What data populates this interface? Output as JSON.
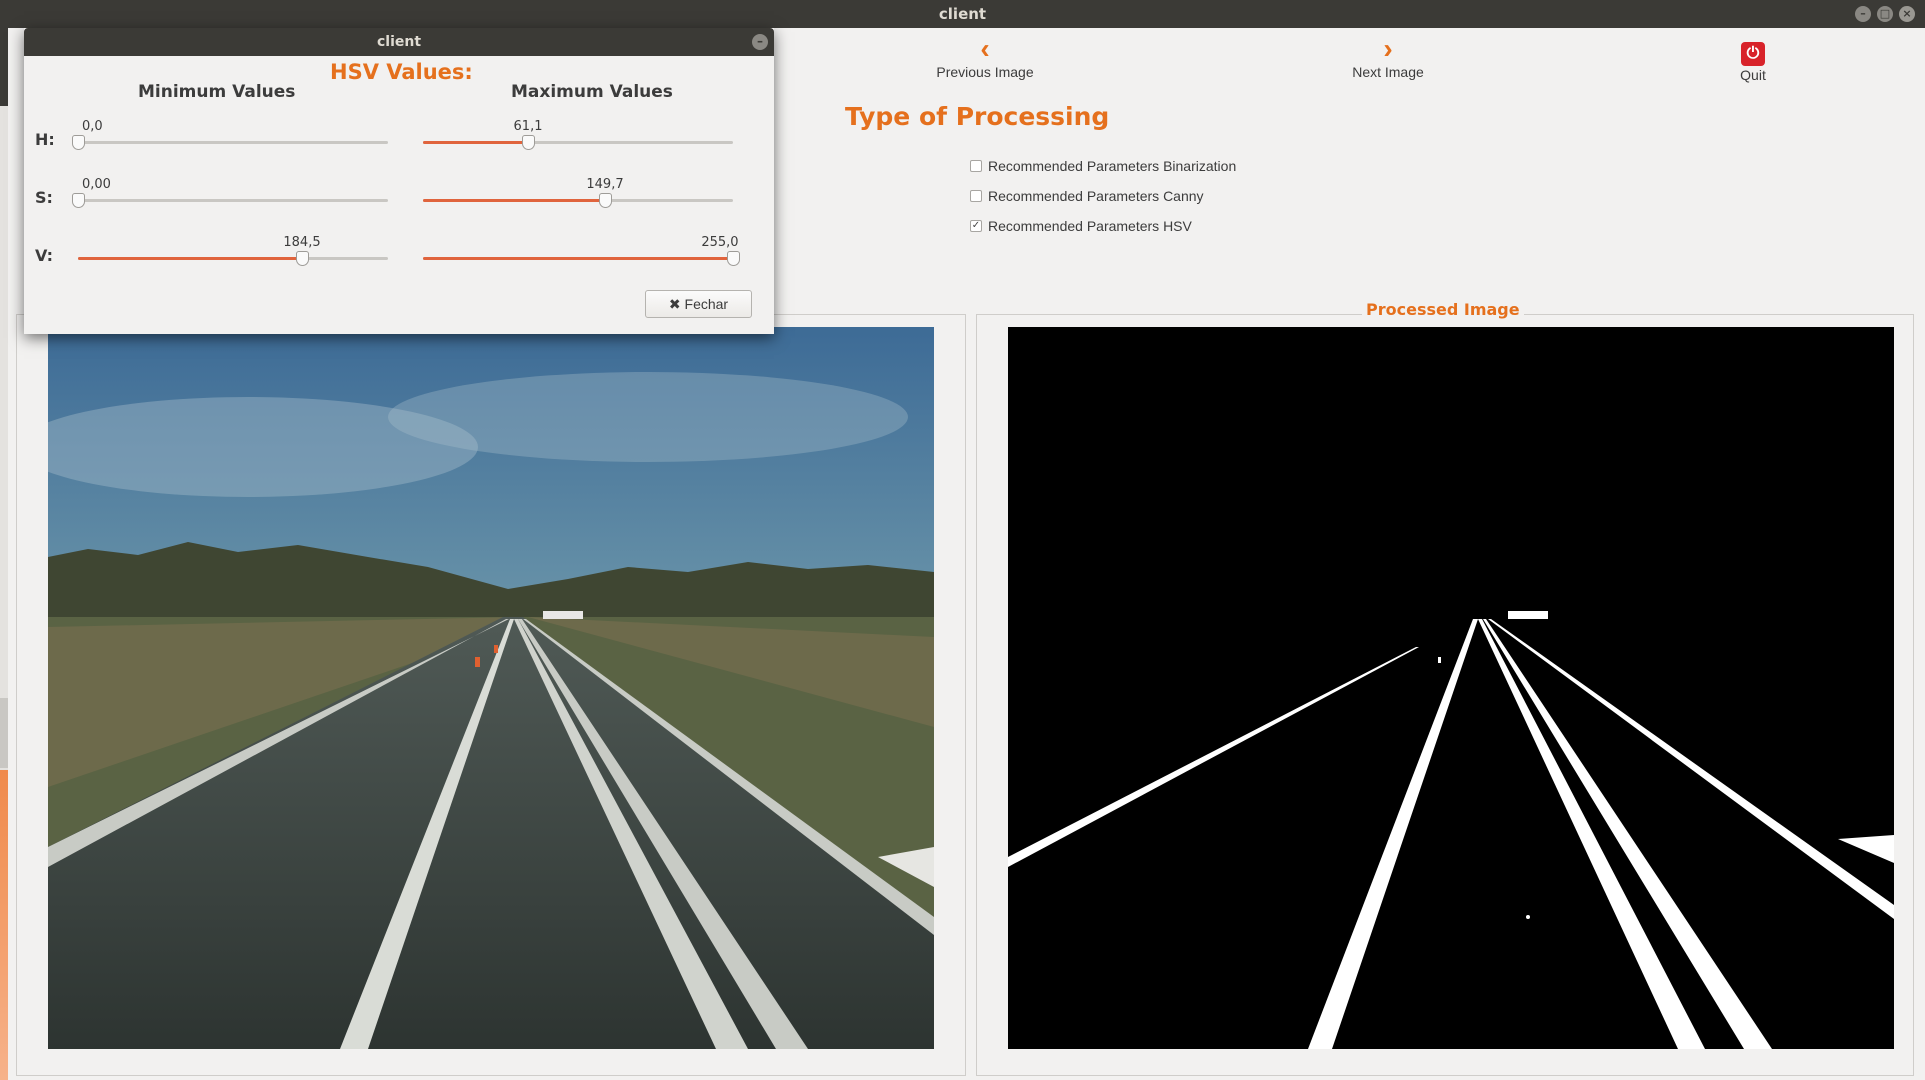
{
  "window": {
    "title": "client",
    "controls": [
      "–",
      "□",
      "×"
    ]
  },
  "toolbar": {
    "previous": {
      "label": "Previous Image",
      "icon": "‹"
    },
    "next": {
      "label": "Next Image",
      "icon": "›"
    },
    "quit": {
      "label": "Quit",
      "icon": "⏻"
    }
  },
  "processing": {
    "title": "Type of Processing",
    "options": [
      {
        "label": "Recommended Parameters Binarization",
        "checked": false
      },
      {
        "label": "Recommended Parameters Canny",
        "checked": false
      },
      {
        "label": "Recommended Parameters HSV",
        "checked": true
      }
    ]
  },
  "panels": {
    "processed_title": "Processed Image"
  },
  "dialog": {
    "title": "client",
    "heading": "HSV Values:",
    "min_header": "Minimum Values",
    "max_header": "Maximum Values",
    "rows": [
      {
        "label": "H:",
        "min": "0,0",
        "max": "61,1",
        "min_frac": 0.0,
        "max_frac": 0.34
      },
      {
        "label": "S:",
        "min": "0,00",
        "max": "149,7",
        "min_frac": 0.0,
        "max_frac": 0.587
      },
      {
        "label": "V:",
        "min": "184,5",
        "max": "255,0",
        "min_frac": 0.724,
        "max_frac": 1.0
      }
    ],
    "close_label": "✖ Fechar",
    "minimize_icon": "–"
  }
}
